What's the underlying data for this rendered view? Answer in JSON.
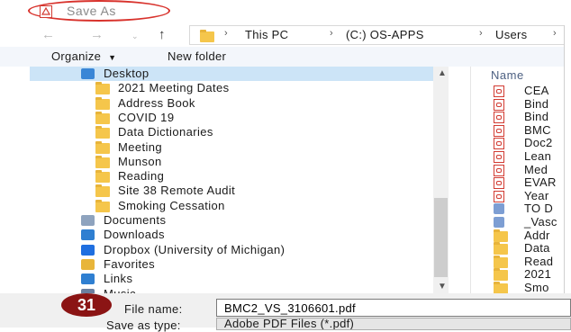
{
  "window": {
    "title": "Save As"
  },
  "nav": {
    "breadcrumbs": [
      "This PC",
      "(C:) OS-APPS",
      "Users"
    ]
  },
  "toolbar": {
    "organize_label": "Organize",
    "new_folder_label": "New folder"
  },
  "tree": {
    "items": [
      {
        "label": "Desktop",
        "type": "desktop",
        "selected": true
      },
      {
        "label": "2021 Meeting Dates",
        "type": "folder"
      },
      {
        "label": "Address Book",
        "type": "folder"
      },
      {
        "label": "COVID 19",
        "type": "folder"
      },
      {
        "label": "Data Dictionaries",
        "type": "folder"
      },
      {
        "label": "Meeting",
        "type": "folder"
      },
      {
        "label": "Munson",
        "type": "folder"
      },
      {
        "label": "Reading",
        "type": "folder"
      },
      {
        "label": "Site 38 Remote Audit",
        "type": "folder"
      },
      {
        "label": "Smoking Cessation",
        "type": "folder"
      },
      {
        "label": "Documents",
        "type": "documents"
      },
      {
        "label": "Downloads",
        "type": "downloads"
      },
      {
        "label": "Dropbox (University of Michigan)",
        "type": "dropbox"
      },
      {
        "label": "Favorites",
        "type": "favorites"
      },
      {
        "label": "Links",
        "type": "links"
      },
      {
        "label": "Music",
        "type": "music"
      }
    ]
  },
  "files": {
    "column_name": "Name",
    "items": [
      {
        "label": "CEA",
        "type": "pdf"
      },
      {
        "label": "Bind",
        "type": "pdf"
      },
      {
        "label": "Bind",
        "type": "pdf"
      },
      {
        "label": "BMC",
        "type": "pdf"
      },
      {
        "label": "Doc2",
        "type": "pdf"
      },
      {
        "label": "Lean",
        "type": "pdf"
      },
      {
        "label": "Med",
        "type": "pdf"
      },
      {
        "label": "EVAR",
        "type": "pdf"
      },
      {
        "label": "Year",
        "type": "pdf"
      },
      {
        "label": "TO D",
        "type": "link"
      },
      {
        "label": "_Vasc",
        "type": "link"
      },
      {
        "label": "Addr",
        "type": "folder"
      },
      {
        "label": "Data",
        "type": "folder"
      },
      {
        "label": "Read",
        "type": "folder"
      },
      {
        "label": "2021",
        "type": "folder"
      },
      {
        "label": "Smo",
        "type": "folder"
      }
    ]
  },
  "bottom": {
    "step_number": "31",
    "file_name_label": "File name:",
    "file_name_value": "BMC2_VS_3106601.pdf",
    "save_type_label": "Save as type:",
    "save_type_value": "Adobe PDF Files (*.pdf)"
  },
  "colors": {
    "selection": "#cce4f7",
    "folder": "#f5c64b",
    "annotation_red": "#d8322c",
    "badge": "#8b1414"
  }
}
